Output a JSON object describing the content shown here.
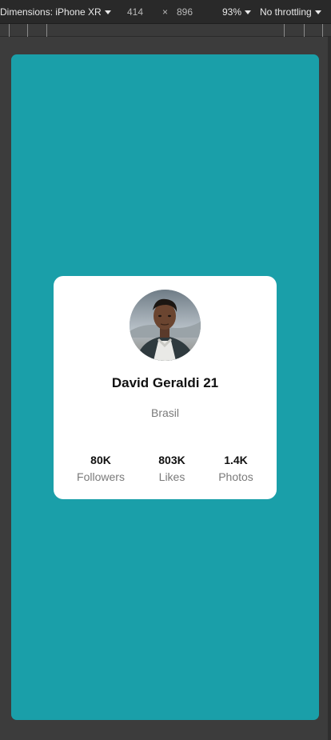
{
  "devtools": {
    "dimensions_label": "Dimensions: iPhone XR",
    "width": "414",
    "times": "×",
    "height": "896",
    "zoom": "93%",
    "throttling": "No throttling"
  },
  "profile": {
    "name": "David Geraldi 21",
    "location": "Brasil",
    "stats": [
      {
        "value": "80K",
        "label": "Followers"
      },
      {
        "value": "803K",
        "label": "Likes"
      },
      {
        "value": "1.4K",
        "label": "Photos"
      }
    ]
  },
  "colors": {
    "background": "#1a9fa9",
    "card": "#ffffff"
  }
}
